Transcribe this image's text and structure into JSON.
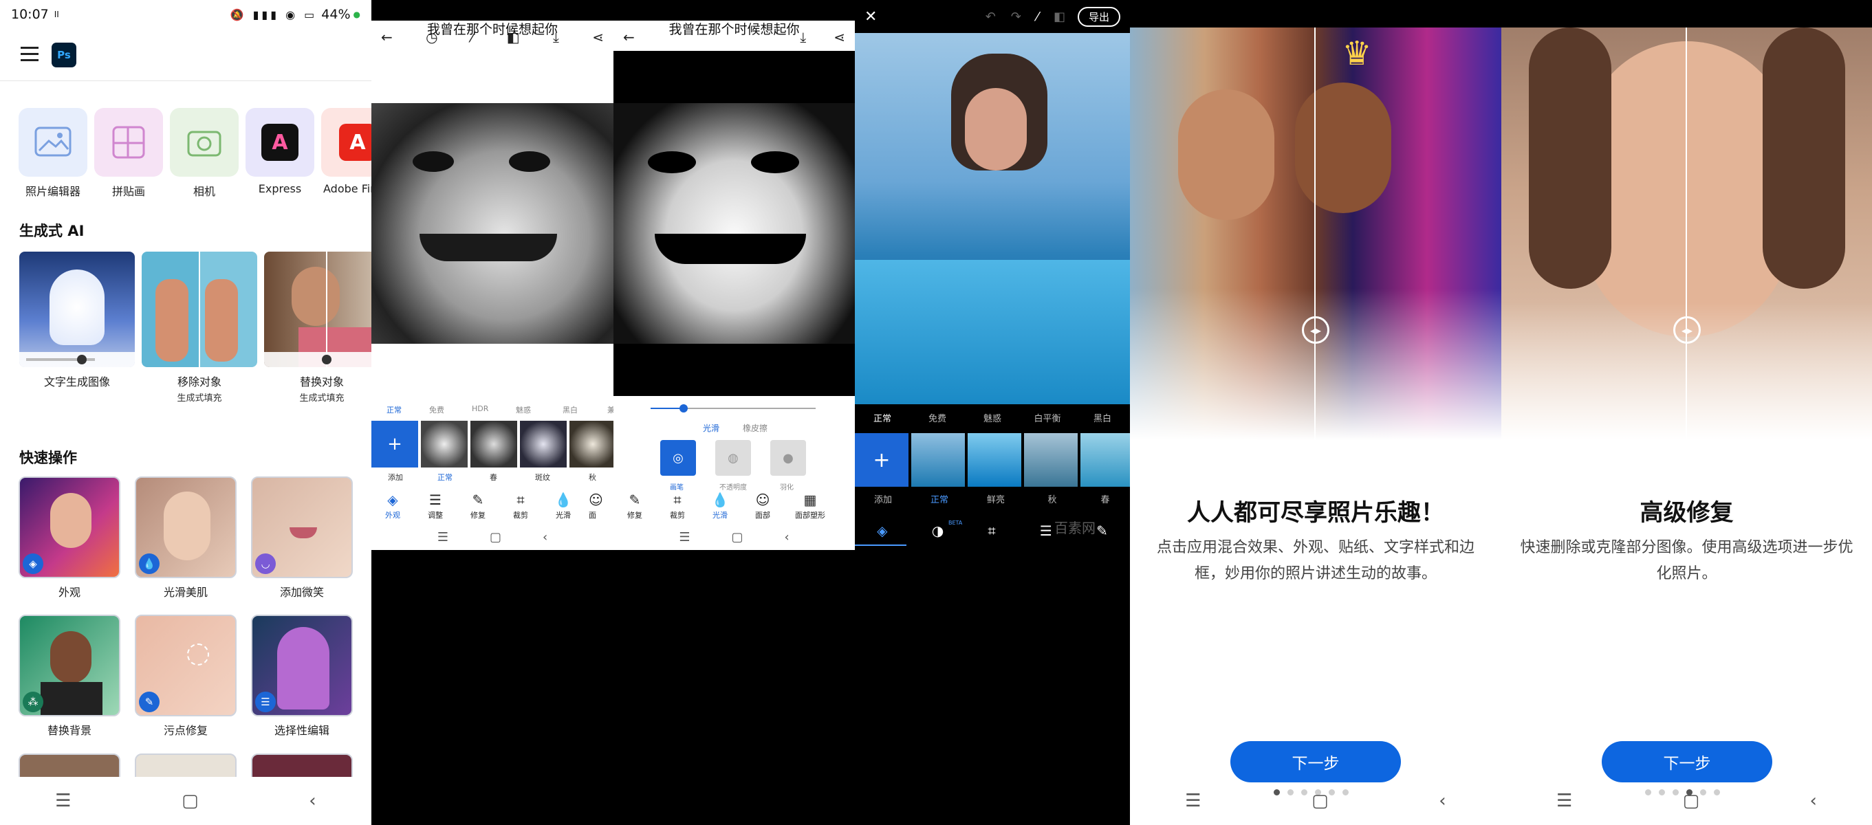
{
  "status": {
    "time": "10:07",
    "pause_mark": "II",
    "battery": "44%"
  },
  "home": {
    "ps_logo": "Ps",
    "apps": [
      {
        "label": "照片编辑器",
        "icon": "photo-editor-icon",
        "color": "#e7eefc"
      },
      {
        "label": "拼贴画",
        "icon": "collage-icon",
        "color": "#f6e3f5"
      },
      {
        "label": "相机",
        "icon": "camera-icon",
        "color": "#e8f3e4"
      },
      {
        "label": "Express",
        "icon": "express-icon",
        "color": "#e8e6fb"
      },
      {
        "label": "Adobe Fir",
        "icon": "adobe-firefly-icon",
        "color": "#fde5e2"
      }
    ],
    "gen_ai_title": "生成式 AI",
    "gen_ai": [
      {
        "label": "文字生成图像",
        "sub": ""
      },
      {
        "label": "移除对象",
        "sub": "生成式填充"
      },
      {
        "label": "替换对象",
        "sub": "生成式填充"
      }
    ],
    "quick_title": "快速操作",
    "quick": [
      {
        "label": "外观",
        "icon": "looks-icon"
      },
      {
        "label": "光滑美肌",
        "icon": "drop-icon"
      },
      {
        "label": "添加微笑",
        "icon": "smile-icon"
      },
      {
        "label": "替换背景",
        "icon": "pattern-icon"
      },
      {
        "label": "污点修复",
        "icon": "bandage-icon"
      },
      {
        "label": "选择性编辑",
        "icon": "sliders-icon"
      }
    ]
  },
  "editor1": {
    "caption": "我曾在那个时候想起你",
    "filters": [
      "正常",
      "免费",
      "HDR",
      "魅惑",
      "黑白",
      "兼"
    ],
    "thumb_labels": [
      "添加",
      "正常",
      "春",
      "斑纹",
      "秋"
    ],
    "tools": [
      "外观",
      "调整",
      "修复",
      "裁剪",
      "光滑",
      "面"
    ]
  },
  "editor2": {
    "caption": "我曾在那个时候想起你",
    "modes": [
      "光滑",
      "橡皮擦"
    ],
    "options": [
      "画笔",
      "不透明度",
      "羽化"
    ],
    "tools": [
      "修复",
      "裁剪",
      "光滑",
      "面部",
      "面部塑形"
    ]
  },
  "editor3": {
    "export_label": "导出",
    "filters": [
      "正常",
      "免费",
      "魅惑",
      "白平衡",
      "黑白"
    ],
    "thumb_labels": [
      "添加",
      "正常",
      "鲜亮",
      "秋",
      "春"
    ],
    "beta": "BETA",
    "watermark": "百素网"
  },
  "intro1": {
    "title": "人人都可尽享照片乐趣！",
    "desc": "点击应用混合效果、外观、贴纸、文字样式和边框，妙用你的照片讲述生动的故事。",
    "button": "下一步",
    "active_dot": 0
  },
  "intro2": {
    "title": "高级修复",
    "desc": "快速删除或克隆部分图像。使用高级选项进一步优化照片。",
    "button": "下一步",
    "active_dot": 3
  },
  "colors": {
    "accent": "#0d66e0",
    "bg_dark": "#000000"
  }
}
